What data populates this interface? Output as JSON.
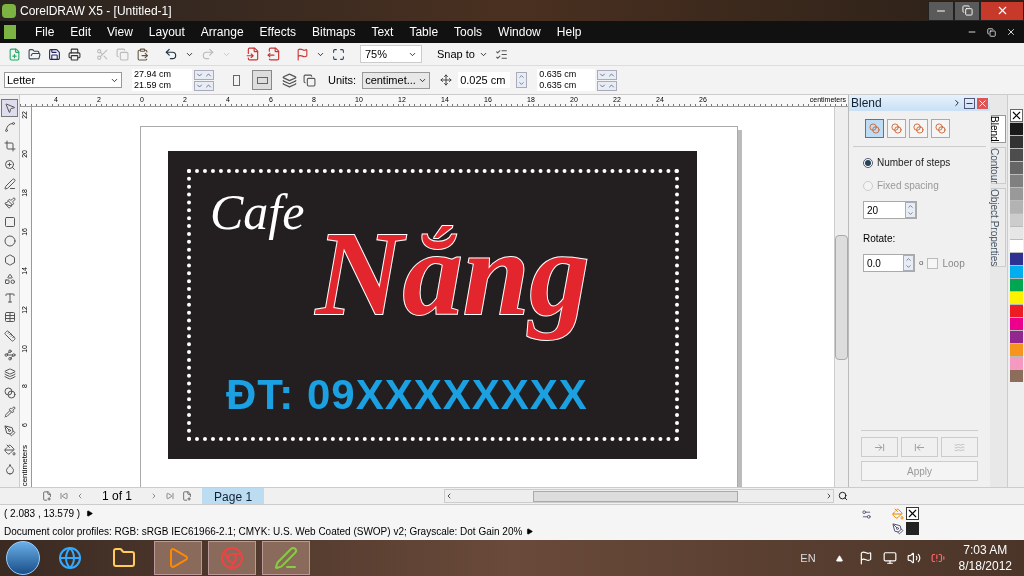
{
  "window": {
    "title": "CorelDRAW X5 - [Untitled-1]"
  },
  "menu": [
    "File",
    "Edit",
    "View",
    "Layout",
    "Arrange",
    "Effects",
    "Bitmaps",
    "Text",
    "Table",
    "Tools",
    "Window",
    "Help"
  ],
  "toolbar": {
    "zoom": "75%",
    "snap": "Snap to"
  },
  "property_bar": {
    "paper": "Letter",
    "width": "27.94 cm",
    "height": "21.59 cm",
    "landscape": true,
    "units_label": "Units:",
    "units": "centimet...",
    "nudge": "0.025 cm",
    "duplicate_x": "0.635 cm",
    "duplicate_y": "0.635 cm"
  },
  "rulers": {
    "horizontal": [
      "4",
      "2",
      "0",
      "2",
      "4",
      "6",
      "8",
      "10",
      "12",
      "14",
      "16",
      "18",
      "20",
      "22",
      "24",
      "26"
    ],
    "horizontal_unit": "centimeters",
    "vertical": [
      "22",
      "20",
      "18",
      "16",
      "14",
      "12",
      "10",
      "8",
      "6"
    ],
    "vertical_unit": "centimeters"
  },
  "toolbox": [
    {
      "selected": true
    },
    {
      "selected": false
    },
    {
      "selected": false
    },
    {
      "selected": false
    },
    {
      "selected": false
    },
    {
      "selected": false
    },
    {
      "selected": false
    },
    {
      "selected": false
    },
    {
      "selected": false
    },
    {
      "selected": false
    },
    {
      "selected": false
    },
    {
      "selected": false
    },
    {
      "selected": false
    },
    {
      "selected": false
    },
    {
      "selected": false
    },
    {
      "selected": false
    },
    {
      "selected": false
    },
    {
      "selected": false
    },
    {
      "selected": false
    },
    {
      "selected": false
    }
  ],
  "artwork": {
    "title": "Cafe",
    "name": "Nắng",
    "phone": "ĐT: 09XXXXXXXX"
  },
  "page_nav": {
    "count": "1 of 1",
    "tabs": [
      {
        "label": "Page 1",
        "selected": true
      }
    ]
  },
  "status": {
    "coordinates": "( 2.083 , 13.579 )",
    "profiles": "Document color profiles: RGB: sRGB IEC61966-2.1; CMYK: U.S. Web Coated (SWOP) v2; Grayscale: Dot Gain 20%"
  },
  "docker": {
    "title": "Blend",
    "modes": [
      {
        "selected": true
      },
      {
        "selected": false
      },
      {
        "selected": false
      },
      {
        "selected": false
      }
    ],
    "step_options": [
      {
        "label": "Number of steps",
        "selected": true,
        "disabled": false
      },
      {
        "label": "Fixed spacing",
        "selected": false,
        "disabled": true
      }
    ],
    "steps": "20",
    "rotate_label": "Rotate:",
    "rotate": "0.0",
    "degree": "o",
    "loop": {
      "label": "Loop",
      "checked": false
    },
    "apply": "Apply"
  },
  "docker_tabs": [
    {
      "label": "Blend",
      "selected": true
    },
    {
      "label": "Contour",
      "selected": false
    },
    {
      "label": "Object Properties",
      "selected": false
    }
  ],
  "palette": [
    {
      "color": "#1a1a1a"
    },
    {
      "color": "#333333"
    },
    {
      "color": "#4d4d4d"
    },
    {
      "color": "#666666"
    },
    {
      "color": "#808080"
    },
    {
      "color": "#999999"
    },
    {
      "color": "#b3b3b3"
    },
    {
      "color": "#cccccc"
    },
    {
      "color": "#e6e6e6"
    },
    {
      "color": "#ffffff"
    },
    {
      "color": "#2e3192"
    },
    {
      "color": "#00aeef"
    },
    {
      "color": "#00a651"
    },
    {
      "color": "#fff200"
    },
    {
      "color": "#ed1c24"
    },
    {
      "color": "#ec008c"
    },
    {
      "color": "#92278f"
    },
    {
      "color": "#f7941d"
    },
    {
      "color": "#f49ac1"
    },
    {
      "color": "#8c6d5b"
    }
  ],
  "taskbar": {
    "apps": [
      {
        "running": false
      },
      {
        "running": false
      },
      {
        "running": true
      },
      {
        "running": true
      },
      {
        "running": true
      }
    ],
    "language": "EN",
    "time": "7:03 AM",
    "date": "8/18/2012"
  }
}
